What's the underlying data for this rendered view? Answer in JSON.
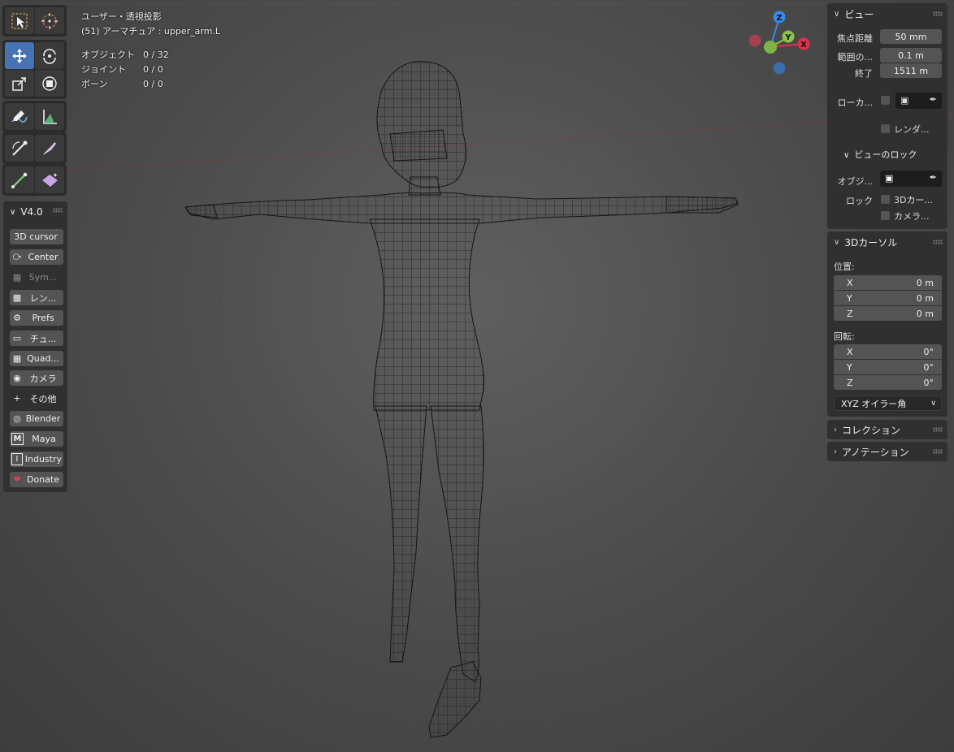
{
  "viewport": {
    "view_title": "ユーザー・透視投影",
    "active_info": "(51) アーマチュア : upper_arm.L",
    "stats": [
      {
        "label": "オブジェクト",
        "value": "0 / 32"
      },
      {
        "label": "ジョイント",
        "value": "0 / 0"
      },
      {
        "label": "ボーン",
        "value": "0 / 0"
      }
    ],
    "gizmo": {
      "x": "X",
      "y": "Y",
      "z": "Z",
      "x_color": "#e0304a",
      "y_color": "#8bc34a",
      "z_color": "#3a89e6"
    }
  },
  "toolbar": {
    "tools": [
      "select-box-icon",
      "cursor-icon",
      "move-icon",
      "rotate-icon",
      "scale-icon",
      "transform-icon",
      "annotate-icon",
      "measure-icon",
      "bone-roll-icon",
      "bone-size-icon",
      "extrude-icon",
      "bone-envelope-icon"
    ]
  },
  "v4panel": {
    "title": "V4.0",
    "buttons": [
      {
        "label": "3D cursor",
        "icon": ""
      },
      {
        "label": "Center",
        "icon": "center-icon"
      },
      {
        "label": "Sym...",
        "icon": "symmetry-icon"
      },
      {
        "label": "レン...",
        "icon": "render-icon"
      },
      {
        "label": "Prefs",
        "icon": "gear-icon"
      },
      {
        "label": "チュ...",
        "icon": "tutorial-icon"
      },
      {
        "label": "Quad...",
        "icon": "grid-icon"
      },
      {
        "label": "カメラ",
        "icon": "camera-icon"
      },
      {
        "label": "その他",
        "icon": "plus-icon"
      },
      {
        "label": "Blender",
        "icon": "blender-icon"
      },
      {
        "label": "Maya",
        "icon": "maya-icon"
      },
      {
        "label": "Industry",
        "icon": "industry-icon"
      },
      {
        "label": "Donate",
        "icon": "heart-icon"
      }
    ]
  },
  "npanel": {
    "view": {
      "title": "ビュー",
      "focal_label": "焦点距離",
      "focal_value": "50 mm",
      "clip_start_label": "範囲の...",
      "clip_start_value": "0.1 m",
      "clip_end_label": "終了",
      "clip_end_value": "1511 m",
      "local_camera_label": "ローカ...",
      "render_region_label": "レンダ...",
      "lock_title": "ビューのロック",
      "lock_object_label": "オブジ...",
      "lock_label": "ロック",
      "lock_3dcursor_label": "3Dカー...",
      "lock_camera_label": "カメラ..."
    },
    "cursor": {
      "title": "3Dカーソル",
      "location_label": "位置:",
      "location": [
        {
          "axis": "X",
          "value": "0 m"
        },
        {
          "axis": "Y",
          "value": "0 m"
        },
        {
          "axis": "Z",
          "value": "0 m"
        }
      ],
      "rotation_label": "回転:",
      "rotation": [
        {
          "axis": "X",
          "value": "0°"
        },
        {
          "axis": "Y",
          "value": "0°"
        },
        {
          "axis": "Z",
          "value": "0°"
        }
      ],
      "rotation_mode": "XYZ オイラー角"
    },
    "collection": {
      "title": "コレクション"
    },
    "annotation": {
      "title": "アノテーション"
    }
  }
}
